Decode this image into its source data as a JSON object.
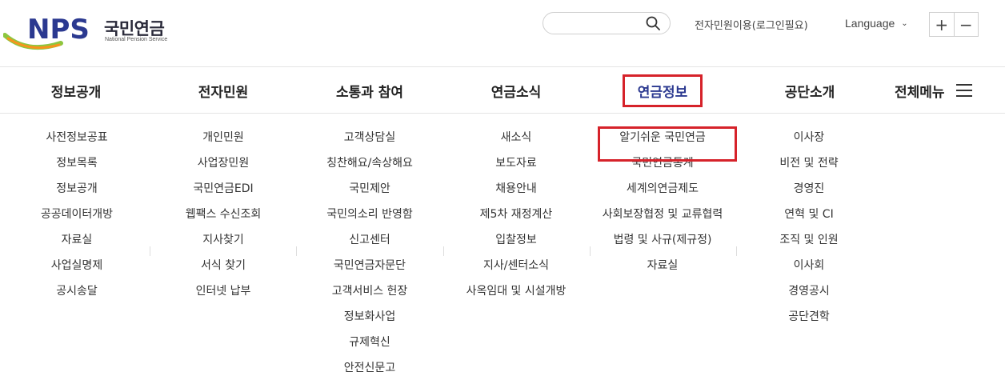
{
  "header": {
    "logo": {
      "mark": "NPS",
      "name_kr": "국민연금",
      "name_en": "National Pension Service"
    },
    "search": {
      "placeholder": "",
      "value": ""
    },
    "login_link": "전자민원이용(로그인필요)",
    "language_label": "Language",
    "zoom_in_label": "+",
    "zoom_out_label": "−"
  },
  "gnb": {
    "items": [
      {
        "label": "정보공개"
      },
      {
        "label": "전자민원"
      },
      {
        "label": "소통과 참여"
      },
      {
        "label": "연금소식"
      },
      {
        "label": "연금정보"
      },
      {
        "label": "공단소개"
      }
    ],
    "all_menu_label": "전체메뉴"
  },
  "submenus": [
    [
      "사전정보공표",
      "정보목록",
      "정보공개",
      "공공데이터개방",
      "자료실",
      "사업실명제",
      "공시송달"
    ],
    [
      "개인민원",
      "사업장민원",
      "국민연금EDI",
      "웹팩스 수신조회",
      "지사찾기",
      "서식 찾기",
      "인터넷 납부"
    ],
    [
      "고객상담실",
      "칭찬해요/속상해요",
      "국민제안",
      "국민의소리 반영함",
      "신고센터",
      "국민연금자문단",
      "고객서비스 헌장",
      "정보화사업",
      "규제혁신",
      "안전신문고"
    ],
    [
      "새소식",
      "보도자료",
      "채용안내",
      "제5차 재정계산",
      "입찰정보",
      "지사/센터소식",
      "사옥임대 및 시설개방"
    ],
    [
      "알기쉬운 국민연금",
      "국민연금통계",
      "세계의연금제도",
      "사회보장협정 및 교류협력",
      "법령 및 사규(제규정)",
      "자료실"
    ],
    [
      "이사장",
      "비전 및 전략",
      "경영진",
      "연혁 및 CI",
      "조직 및 인원",
      "이사회",
      "경영공시",
      "공단견학"
    ]
  ],
  "colors": {
    "accent_red": "#d6222a",
    "brand_navy": "#2b3990",
    "logo_green": "#8dc63f",
    "logo_orange": "#f7941d"
  }
}
